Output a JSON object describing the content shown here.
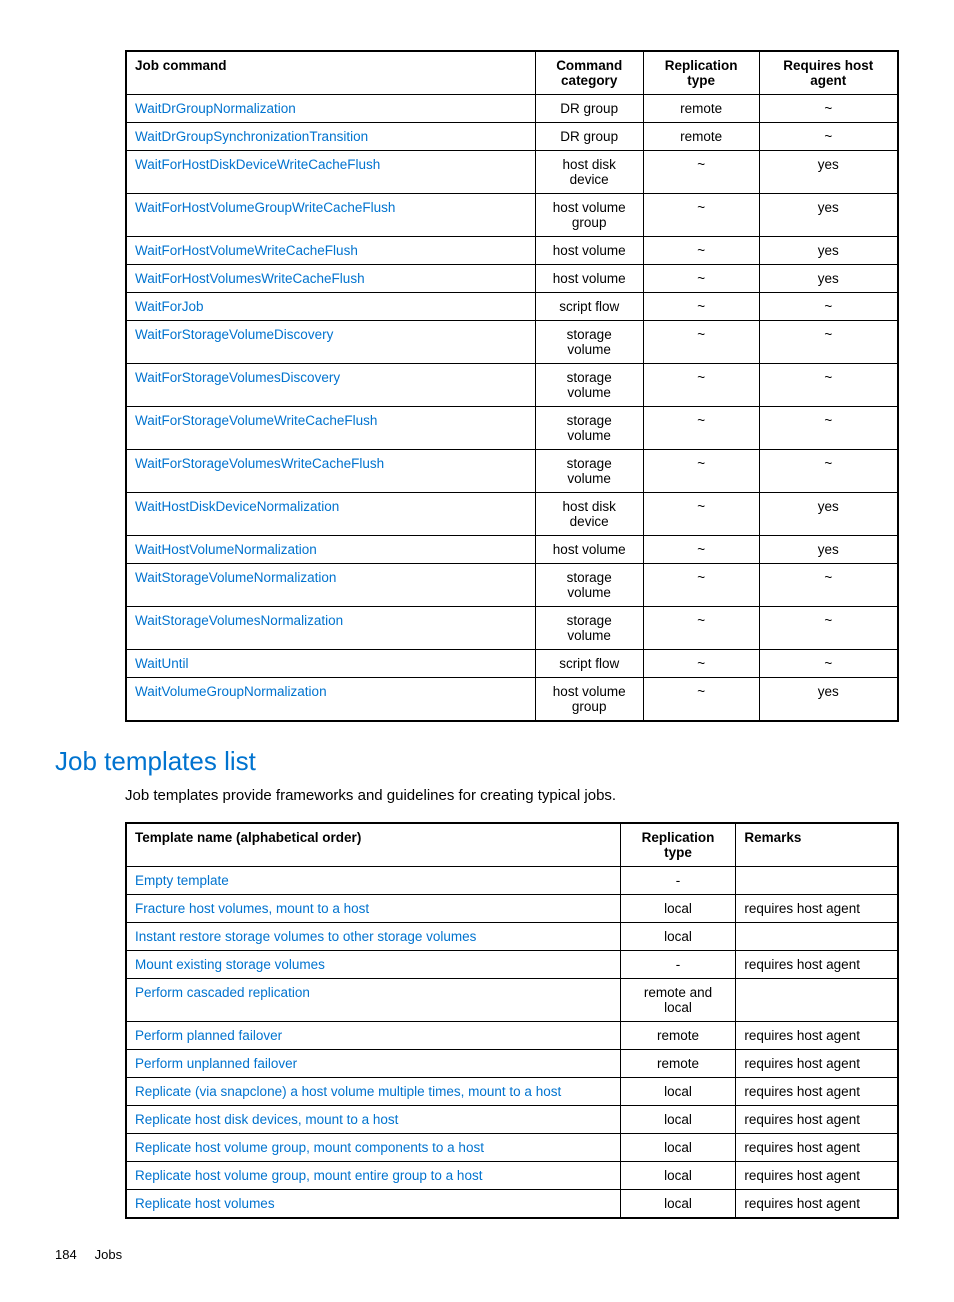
{
  "table1": {
    "headers": {
      "c1": "Job command",
      "c2": "Command category",
      "c3": "Replication type",
      "c4": "Requires host agent"
    },
    "rows": [
      {
        "cmd": "WaitDrGroupNormalization",
        "cat": "DR group",
        "rep": "remote",
        "host": "~"
      },
      {
        "cmd": "WaitDrGroupSynchronizationTransition",
        "cat": "DR group",
        "rep": "remote",
        "host": "~"
      },
      {
        "cmd": "WaitForHostDiskDeviceWriteCacheFlush",
        "cat": "host disk device",
        "rep": "~",
        "host": "yes"
      },
      {
        "cmd": "WaitForHostVolumeGroupWriteCacheFlush",
        "cat": "host volume group",
        "rep": "~",
        "host": "yes"
      },
      {
        "cmd": "WaitForHostVolumeWriteCacheFlush",
        "cat": "host volume",
        "rep": "~",
        "host": "yes"
      },
      {
        "cmd": "WaitForHostVolumesWriteCacheFlush",
        "cat": "host volume",
        "rep": "~",
        "host": "yes"
      },
      {
        "cmd": "WaitForJob",
        "cat": "script flow",
        "rep": "~",
        "host": "~"
      },
      {
        "cmd": "WaitForStorageVolumeDiscovery",
        "cat": "storage volume",
        "rep": "~",
        "host": "~"
      },
      {
        "cmd": "WaitForStorageVolumesDiscovery",
        "cat": "storage volume",
        "rep": "~",
        "host": "~"
      },
      {
        "cmd": "WaitForStorageVolumeWriteCacheFlush",
        "cat": "storage volume",
        "rep": "~",
        "host": "~"
      },
      {
        "cmd": "WaitForStorageVolumesWriteCacheFlush",
        "cat": "storage volume",
        "rep": "~",
        "host": "~"
      },
      {
        "cmd": "WaitHostDiskDeviceNormalization",
        "cat": "host disk device",
        "rep": "~",
        "host": "yes"
      },
      {
        "cmd": "WaitHostVolumeNormalization",
        "cat": "host volume",
        "rep": "~",
        "host": "yes"
      },
      {
        "cmd": "WaitStorageVolumeNormalization",
        "cat": "storage volume",
        "rep": "~",
        "host": "~"
      },
      {
        "cmd": "WaitStorageVolumesNormalization",
        "cat": "storage volume",
        "rep": "~",
        "host": "~"
      },
      {
        "cmd": "WaitUntil",
        "cat": "script flow",
        "rep": "~",
        "host": "~"
      },
      {
        "cmd": "WaitVolumeGroupNormalization",
        "cat": "host volume group",
        "rep": "~",
        "host": "yes"
      }
    ]
  },
  "section": {
    "title": "Job templates list",
    "intro": "Job templates provide frameworks and guidelines for creating typical jobs."
  },
  "table2": {
    "headers": {
      "c1": "Template name (alphabetical order)",
      "c2": "Replication type",
      "c3": "Remarks"
    },
    "rows": [
      {
        "name": "Empty template",
        "rep": "-",
        "rem": ""
      },
      {
        "name": "Fracture host volumes, mount to a host",
        "rep": "local",
        "rem": "requires host agent"
      },
      {
        "name": "Instant restore storage volumes to other storage volumes",
        "rep": "local",
        "rem": ""
      },
      {
        "name": "Mount existing storage volumes",
        "rep": "-",
        "rem": "requires host agent"
      },
      {
        "name": "Perform cascaded replication",
        "rep": "remote and local",
        "rem": ""
      },
      {
        "name": "Perform planned failover",
        "rep": "remote",
        "rem": "requires host agent"
      },
      {
        "name": "Perform unplanned failover",
        "rep": "remote",
        "rem": "requires host agent"
      },
      {
        "name": "Replicate (via snapclone) a host volume multiple times, mount to a host",
        "rep": "local",
        "rem": "requires host agent"
      },
      {
        "name": "Replicate host disk devices, mount to a host",
        "rep": "local",
        "rem": "requires host agent"
      },
      {
        "name": "Replicate host volume group, mount components to a host",
        "rep": "local",
        "rem": "requires host agent"
      },
      {
        "name": "Replicate host volume group, mount entire group to a host",
        "rep": "local",
        "rem": "requires host agent"
      },
      {
        "name": "Replicate host volumes",
        "rep": "local",
        "rem": "requires host agent"
      }
    ]
  },
  "footer": {
    "page": "184",
    "section": "Jobs"
  }
}
